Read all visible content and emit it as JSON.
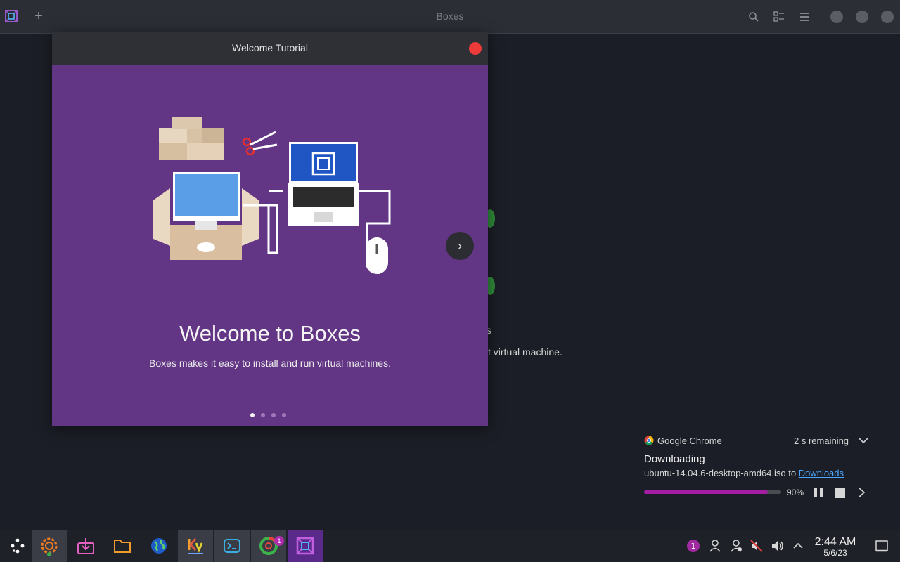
{
  "window": {
    "title": "Boxes"
  },
  "background": {
    "partial_text_1": "s",
    "partial_text_2": "t virtual machine."
  },
  "dialog": {
    "title": "Welcome Tutorial",
    "heading": "Welcome to Boxes",
    "subtitle": "Boxes makes it easy to install and run virtual machines.",
    "page_count": 4,
    "current_page": 1
  },
  "notification": {
    "app_name": "Google Chrome",
    "remaining": "2 s remaining",
    "title": "Downloading",
    "file_text": "ubuntu-14.04.6-desktop-amd64.iso to ",
    "link_text": "Downloads",
    "progress_label": "90%",
    "progress_fraction": 0.9
  },
  "taskbar": {
    "apps": [
      "launcher",
      "system-settings",
      "discover",
      "file-manager",
      "browser",
      "kvantum",
      "terminal",
      "chrome",
      "boxes"
    ],
    "chrome_badge": "1",
    "tray_badge": "1"
  },
  "clock": {
    "time": "2:44 AM",
    "date": "5/6/23"
  },
  "colors": {
    "accent": "#633585",
    "progress": "#a51ca5",
    "close": "#ef3a3a",
    "link": "#4aa6ff"
  }
}
